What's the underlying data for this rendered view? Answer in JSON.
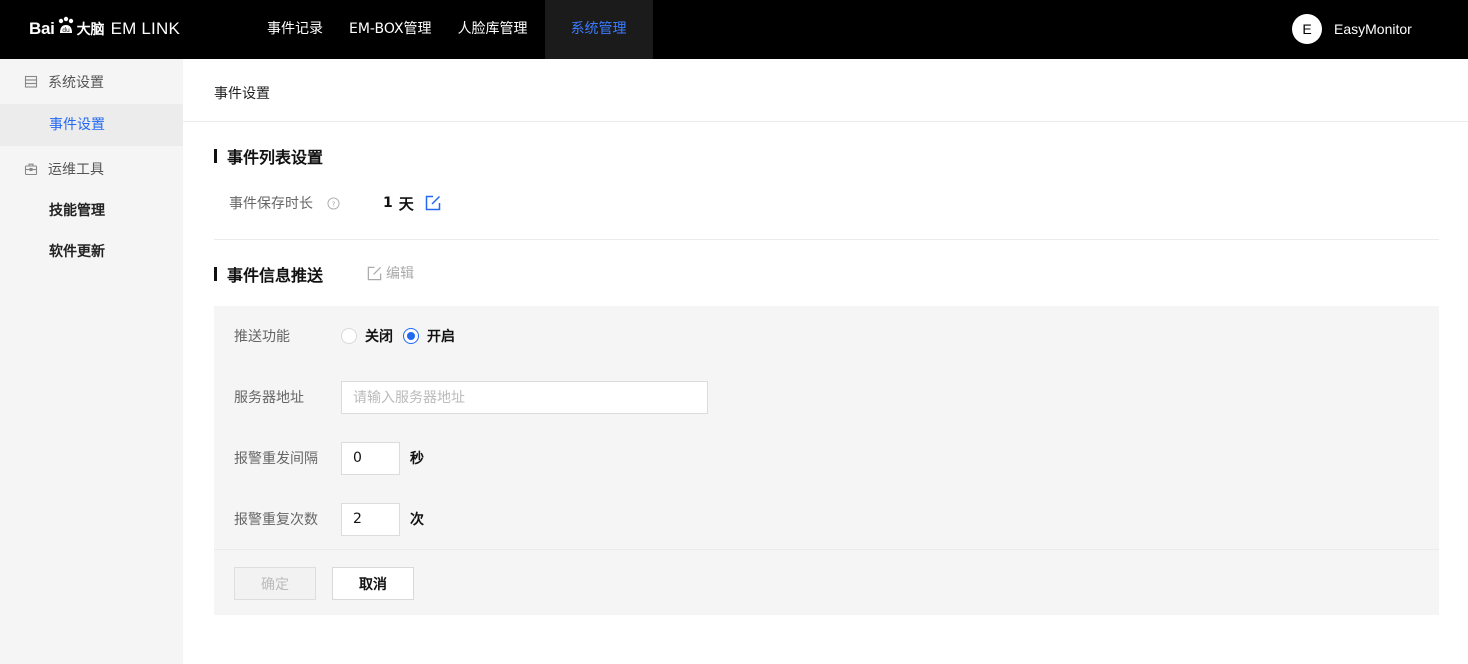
{
  "brand": {
    "bai": "Bai",
    "danao": "大脑",
    "product": "EM LINK"
  },
  "nav": {
    "items": [
      {
        "label": "事件记录"
      },
      {
        "label": "EM-BOX管理"
      },
      {
        "label": "人脸库管理"
      },
      {
        "label": "系统管理"
      }
    ],
    "active_index": 3
  },
  "user": {
    "initial": "E",
    "name": "EasyMonitor"
  },
  "sidebar": {
    "groups": [
      {
        "label": "系统设置",
        "icon": "server-icon",
        "items": [
          {
            "label": "事件设置",
            "active": true
          }
        ]
      },
      {
        "label": "运维工具",
        "icon": "toolbox-icon",
        "items": [
          {
            "label": "技能管理"
          },
          {
            "label": "软件更新"
          }
        ]
      }
    ]
  },
  "breadcrumb": "事件设置",
  "event_list": {
    "title": "事件列表设置",
    "retention_label": "事件保存时长",
    "retention_value": "1",
    "retention_unit": "天"
  },
  "push": {
    "title": "事件信息推送",
    "edit_label": "编辑",
    "function_label": "推送功能",
    "options": [
      {
        "label": "关闭",
        "selected": false
      },
      {
        "label": "开启",
        "selected": true
      }
    ],
    "server_label": "服务器地址",
    "server_placeholder": "请输入服务器地址",
    "server_value": "",
    "interval_label": "报警重发间隔",
    "interval_value": "0",
    "interval_unit": "秒",
    "repeat_label": "报警重复次数",
    "repeat_value": "2",
    "repeat_unit": "次",
    "confirm_label": "确定",
    "cancel_label": "取消"
  },
  "colors": {
    "accent": "#2468f2",
    "topbar": "#000000",
    "sidebar_bg": "#f5f5f5",
    "panel_bg": "#f5f5f5"
  }
}
